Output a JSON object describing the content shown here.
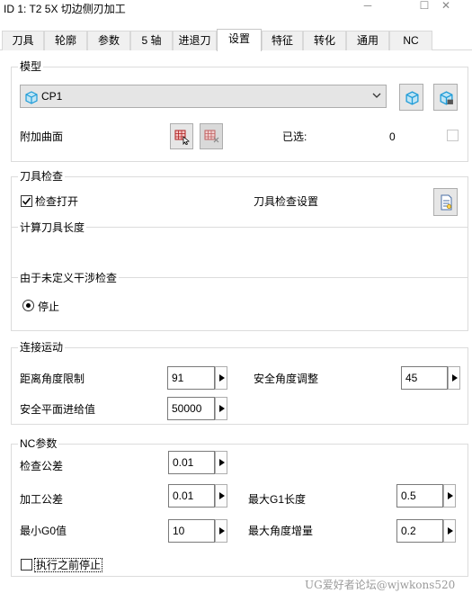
{
  "window": {
    "title": "ID 1: T2 5X 切边侧刃加工",
    "minimize": "─",
    "maximize": "☐",
    "close": "✕"
  },
  "tabs": [
    {
      "label": "刀具",
      "active": false
    },
    {
      "label": "轮廓",
      "active": false
    },
    {
      "label": "参数",
      "active": false
    },
    {
      "label": "5 轴",
      "active": false
    },
    {
      "label": "进退刀",
      "active": false
    },
    {
      "label": "设置",
      "active": true
    },
    {
      "label": "特征",
      "active": false
    },
    {
      "label": "转化",
      "active": false
    },
    {
      "label": "通用",
      "active": false
    },
    {
      "label": "NC",
      "active": false
    }
  ],
  "model": {
    "group_label": "模型",
    "selected": "CP1",
    "extra_surfaces_label": "附加曲面",
    "selected_label": "已选:",
    "selected_count": "0"
  },
  "tool_check": {
    "group_label": "刀具检查",
    "check_open_label": "检查打开",
    "check_open_checked": true,
    "settings_label": "刀具检查设置",
    "calc_length_label": "计算刀具长度",
    "undefined_gouge_label": "由于未定义干涉检查",
    "stop_label": "停止"
  },
  "link_motion": {
    "group_label": "连接运动",
    "distance_angle_limit_label": "距离角度限制",
    "distance_angle_limit_value": "91",
    "safe_angle_adjust_label": "安全角度调整",
    "safe_angle_adjust_value": "45",
    "safe_plane_feed_label": "安全平面进给值",
    "safe_plane_feed_value": "50000"
  },
  "nc_params": {
    "group_label": "NC参数",
    "check_tolerance_label": "检查公差",
    "check_tolerance_value": "0.01",
    "machining_tolerance_label": "加工公差",
    "machining_tolerance_value": "0.01",
    "max_g1_length_label": "最大G1长度",
    "max_g1_length_value": "0.5",
    "min_g0_label": "最小G0值",
    "min_g0_value": "10",
    "max_angle_increment_label": "最大角度增量",
    "max_angle_increment_value": "0.2",
    "stop_before_exec_label": "执行之前停止",
    "stop_before_exec_checked": false
  },
  "watermark": "UG爱好者论坛@wjwkons520",
  "colors": {
    "group_border": "#dcdcdc",
    "button_bg": "#e6e6e6",
    "cube_icon": "#1e9bd7"
  }
}
